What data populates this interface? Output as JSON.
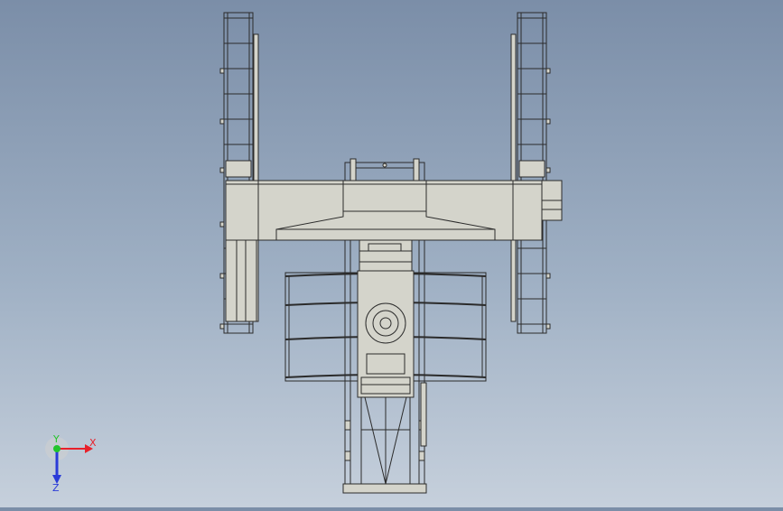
{
  "triad": {
    "x_label": "X",
    "y_label": "Y",
    "z_label": "Z",
    "x_color": "#e8202a",
    "y_color": "#22c42c",
    "z_color": "#2a3bd8"
  },
  "colors": {
    "frame_fill": "#d4d4cb",
    "frame_line": "#2b2b2b"
  }
}
